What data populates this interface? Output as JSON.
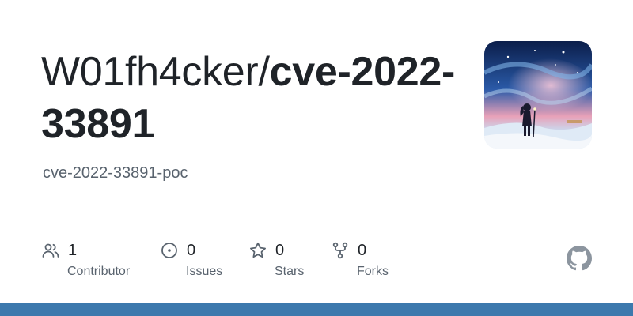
{
  "repo": {
    "owner_prefix": "W01fh4cker/",
    "name": "cve-2022-33891",
    "description": "cve-2022-33891-poc"
  },
  "avatar": {
    "icon": "anime-girl-starry-sky-avatar"
  },
  "stats": [
    {
      "icon": "people-icon",
      "count": "1",
      "label": "Contributor"
    },
    {
      "icon": "issue-opened-icon",
      "count": "0",
      "label": "Issues"
    },
    {
      "icon": "star-icon",
      "count": "0",
      "label": "Stars"
    },
    {
      "icon": "repo-forked-icon",
      "count": "0",
      "label": "Forks"
    }
  ],
  "logo": {
    "icon": "github-mark-icon"
  },
  "colors": {
    "text": "#1f2328",
    "muted": "#59636e",
    "accent_bar": "#3d79ad"
  }
}
